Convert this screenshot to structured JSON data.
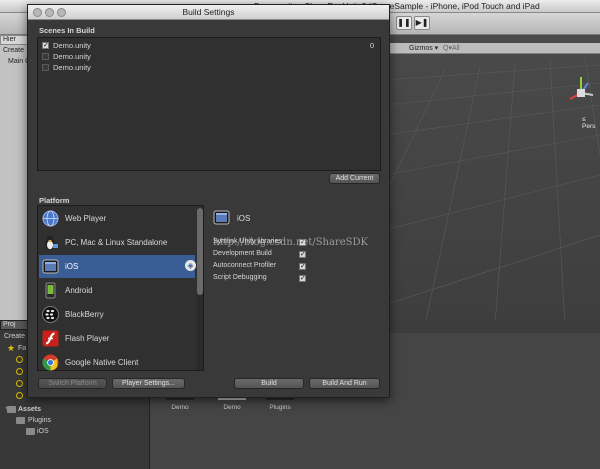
{
  "editor": {
    "window_title": "Demo.unity - ShareRecUnity3dGameSample - iPhone, iPod Touch and iPad",
    "hierarchy_tab": "Hier",
    "hierarchy_create": "Create",
    "hierarchy_item": "Main C",
    "scene_toolbar": {
      "gizmos": "Gizmos ▾",
      "search": "Q▾All"
    },
    "persp_label": "≤ Pers",
    "project_tab": "Proj",
    "project_create": "Create",
    "favorites": "Fa",
    "assets_root": "Assets",
    "assets_tree": [
      "Plugins",
      "iOS"
    ],
    "asset_grid": [
      "Demo",
      "Demo",
      "Plugins"
    ]
  },
  "build_settings": {
    "title": "Build Settings",
    "scenes_header": "Scenes In Build",
    "scenes": [
      {
        "name": "Demo.unity",
        "checked": true,
        "index": "0"
      },
      {
        "name": "Demo.unity",
        "checked": false,
        "index": ""
      },
      {
        "name": "Demo.unity",
        "checked": false,
        "index": ""
      }
    ],
    "add_current": "Add Current",
    "platform_header": "Platform",
    "platforms": [
      {
        "name": "Web Player",
        "icon": "web-player-globe-icon",
        "selected": false
      },
      {
        "name": "PC, Mac & Linux Standalone",
        "icon": "standalone-penguin-icon",
        "selected": false
      },
      {
        "name": "iOS",
        "icon": "ios-device-icon",
        "selected": true
      },
      {
        "name": "Android",
        "icon": "android-phone-icon",
        "selected": false
      },
      {
        "name": "BlackBerry",
        "icon": "blackberry-icon",
        "selected": false
      },
      {
        "name": "Flash Player",
        "icon": "flash-player-icon",
        "selected": false
      },
      {
        "name": "Google Native Client",
        "icon": "chrome-icon",
        "selected": false
      }
    ],
    "selected_platform_title": "iOS",
    "options": [
      {
        "label": "Symlink Unity libraries",
        "checked": true
      },
      {
        "label": "Development Build",
        "checked": true
      },
      {
        "label": "Autoconnect Profiler",
        "checked": true
      },
      {
        "label": "Script Debugging",
        "checked": true
      }
    ],
    "watermark": "http://blog.csdn.net/ShareSDK",
    "buttons": {
      "switch_platform": "Switch Platform",
      "player_settings": "Player Settings...",
      "build": "Build",
      "build_and_run": "Build And Run"
    }
  },
  "colors": {
    "selection": "#3b5d95",
    "window_bg": "#393939",
    "list_bg": "#303030"
  }
}
